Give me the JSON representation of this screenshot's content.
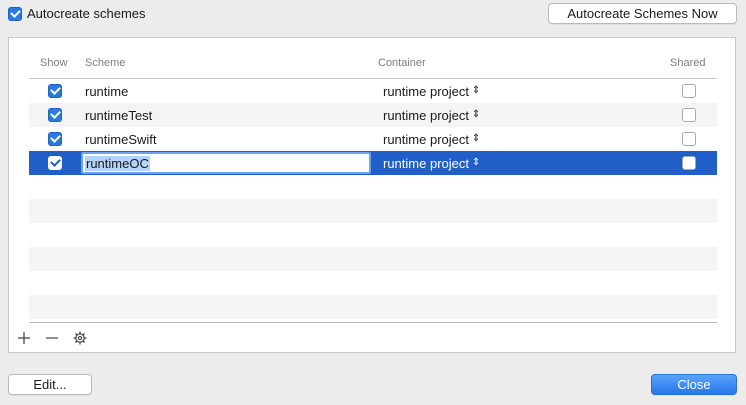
{
  "autocreate": {
    "label": "Autocreate schemes",
    "checked": true
  },
  "buttons": {
    "autocreate_now": "Autocreate Schemes Now",
    "edit": "Edit...",
    "close": "Close"
  },
  "table": {
    "headers": {
      "show": "Show",
      "scheme": "Scheme",
      "container": "Container",
      "shared": "Shared"
    },
    "rows": [
      {
        "show": true,
        "scheme": "runtime",
        "container": "runtime project",
        "shared": false
      },
      {
        "show": true,
        "scheme": "runtimeTest",
        "container": "runtime project",
        "shared": false
      },
      {
        "show": true,
        "scheme": "runtimeSwift",
        "container": "runtime project",
        "shared": false
      },
      {
        "show": true,
        "scheme": "runtimeOC",
        "container": "runtime project",
        "shared": false,
        "selected": true,
        "editing": true
      }
    ]
  },
  "icons": {
    "add": "plus-icon",
    "remove": "minus-icon",
    "settings": "gear-icon",
    "stepper": "up-down-chevron-icon"
  },
  "colors": {
    "accent": "#2a7ae2",
    "selection": "#1f5fc7",
    "primary_button": "#3b86f0"
  }
}
